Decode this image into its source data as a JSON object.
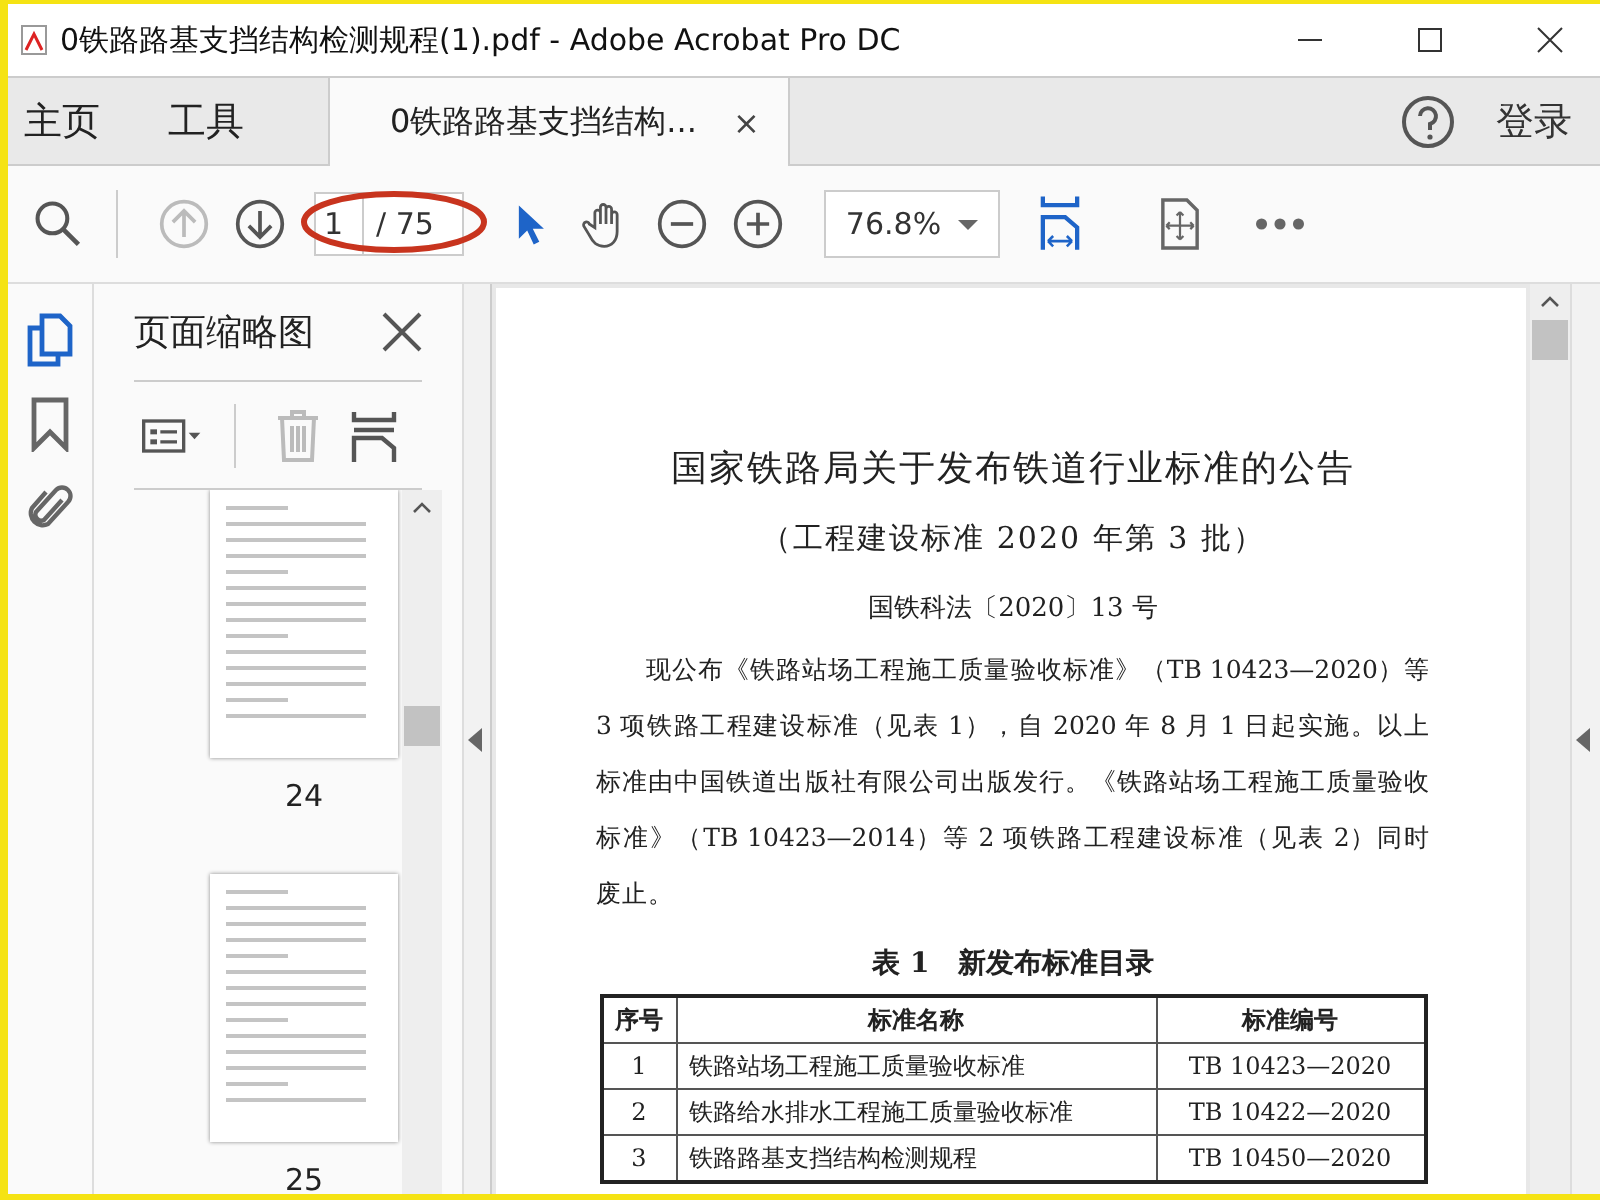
{
  "window": {
    "title": "0铁路路基支挡结构检测规程(1).pdf - Adobe Acrobat Pro DC"
  },
  "tabs": [
    {
      "label": "主页",
      "selected": false
    },
    {
      "label": "工具",
      "selected": false
    },
    {
      "label": "0铁路路基支挡结构...",
      "selected": true,
      "close": "×"
    }
  ],
  "account": {
    "label": "登录"
  },
  "toolbar": {
    "prev_page": {
      "disabled": true
    },
    "next_page": {
      "disabled": false
    },
    "page": "1",
    "total": "/ 75",
    "zoom": "76.8%"
  },
  "rail": [
    {
      "kind": "pages",
      "selected": true
    },
    {
      "kind": "bookmarks",
      "selected": false
    },
    {
      "kind": "attachments",
      "selected": false
    }
  ],
  "sidebar": {
    "title": "页面缩略图",
    "delete_button": {
      "disabled": true
    },
    "thumbnails": [
      {
        "label": "24"
      },
      {
        "label": "25"
      }
    ]
  },
  "document": {
    "title": "国家铁路局关于发布铁道行业标准的公告",
    "subtitle": "（工程建设标准 2020 年第 3 批）",
    "ref": "国铁科法〔2020〕13 号",
    "paragraph": "现公布《铁路站场工程施工质量验收标准》（TB 10423—2020）等 3 项铁路工程建设标准（见表 1），自 2020 年 8 月 1 日起实施。以上标准由中国铁道出版社有限公司出版发行。《铁路站场工程施工质量验收标准》（TB 10423—2014）等 2 项铁路工程建设标准（见表 2）同时废止。",
    "table_caption": "表 1　新发布标准目录",
    "table": {
      "columns": [
        "序号",
        "标准名称",
        "标准编号"
      ],
      "rows": [
        [
          "1",
          "铁路站场工程施工质量验收标准",
          "TB 10423—2020"
        ],
        [
          "2",
          "铁路给水排水工程施工质量验收标准",
          "TB 10422—2020"
        ],
        [
          "3",
          "铁路路基支挡结构检测规程",
          "TB 10450—2020"
        ]
      ]
    }
  }
}
